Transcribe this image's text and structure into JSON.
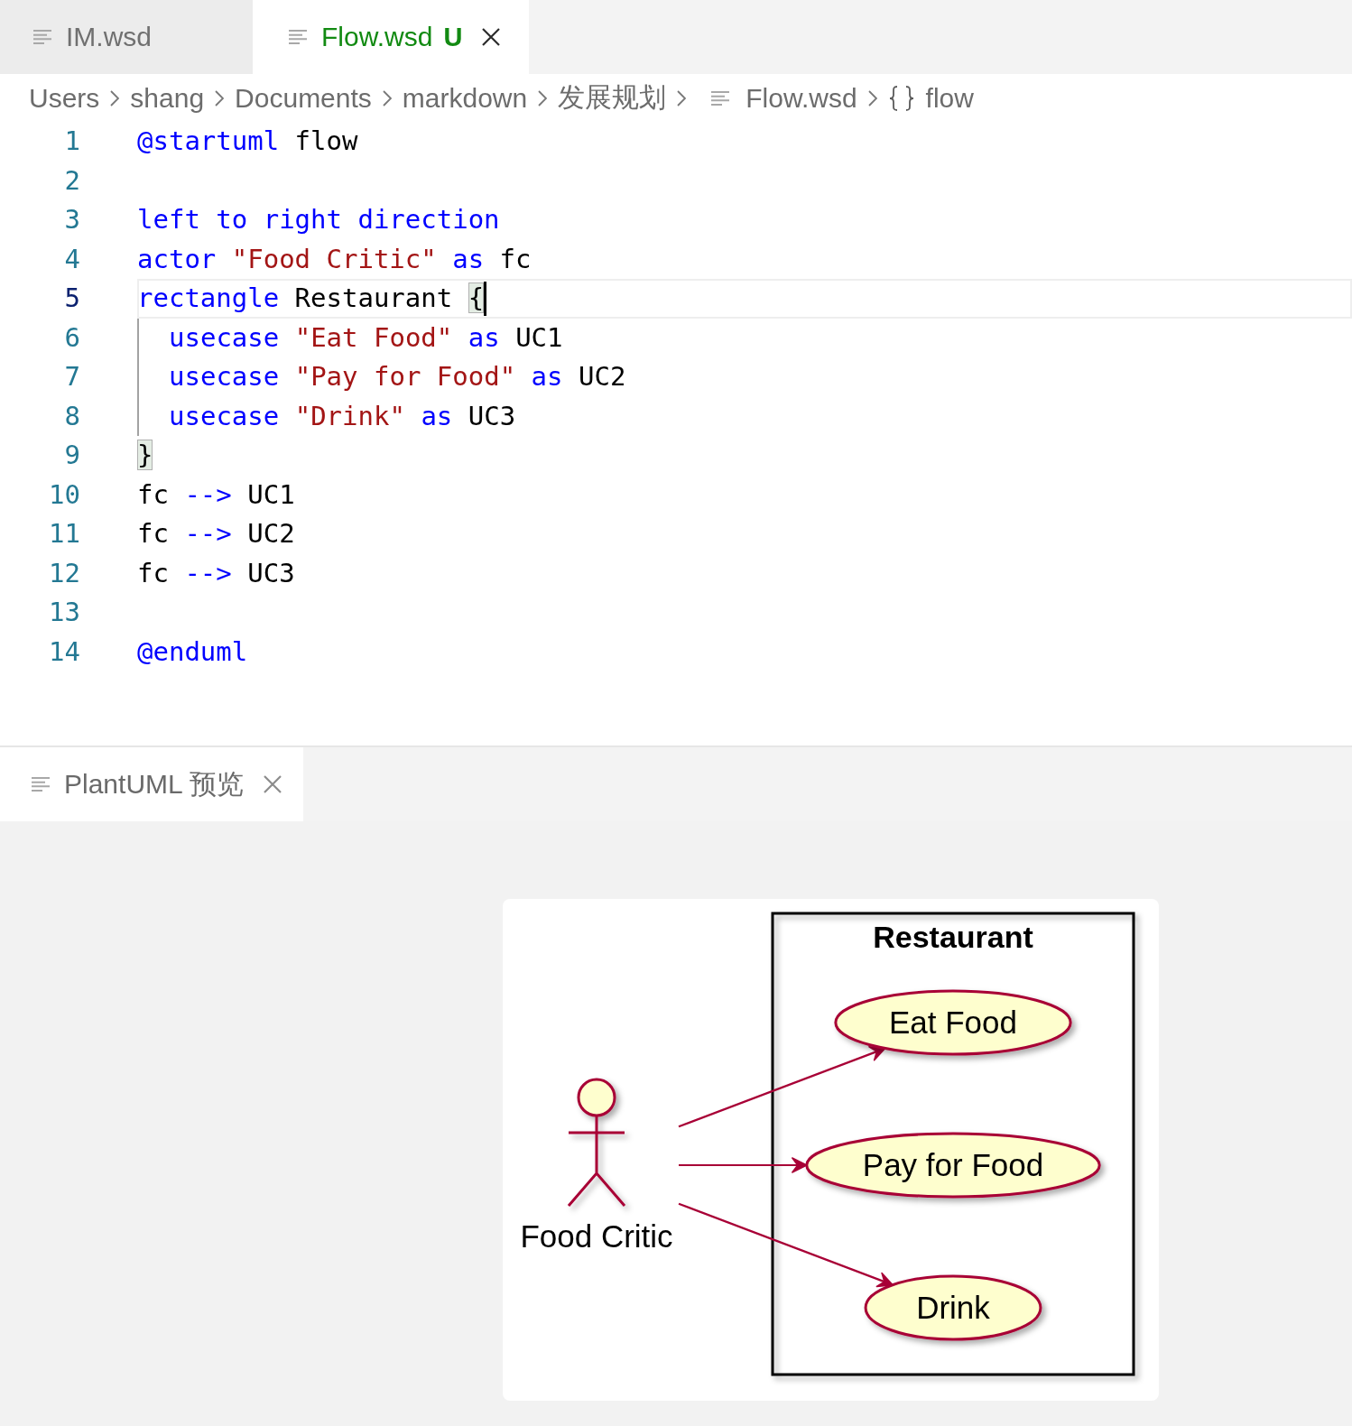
{
  "tabs": [
    {
      "label": "IM.wsd",
      "selected": false
    },
    {
      "label": "Flow.wsd",
      "status": "U",
      "selected": true
    }
  ],
  "breadcrumb": [
    {
      "kind": "folder",
      "label": "Users"
    },
    {
      "kind": "folder",
      "label": "shang"
    },
    {
      "kind": "folder",
      "label": "Documents"
    },
    {
      "kind": "folder",
      "label": "markdown"
    },
    {
      "kind": "folder",
      "label": "发展规划"
    },
    {
      "kind": "file",
      "label": "Flow.wsd"
    },
    {
      "kind": "symbol",
      "label": "flow"
    }
  ],
  "editor": {
    "lines": [
      {
        "number": "1",
        "current": false,
        "indented": false,
        "tokens": [
          {
            "kind": "keyword",
            "text": "@startuml "
          },
          {
            "kind": "plain",
            "text": "flow"
          }
        ]
      },
      {
        "number": "2",
        "current": false,
        "indented": false
      },
      {
        "number": "3",
        "current": false,
        "indented": false,
        "tokens": [
          {
            "kind": "keyword",
            "text": "left to right direction"
          }
        ]
      },
      {
        "number": "4",
        "current": false,
        "indented": false,
        "tokens": [
          {
            "kind": "keyword",
            "text": "actor "
          },
          {
            "kind": "string",
            "text": "\"Food Critic\" "
          },
          {
            "kind": "keyword",
            "text": "as "
          },
          {
            "kind": "plain",
            "text": "fc"
          }
        ]
      },
      {
        "number": "5",
        "current": true,
        "indented": false,
        "tokens": [
          {
            "kind": "keyword",
            "text": "rectangle "
          },
          {
            "kind": "plain",
            "text": "Restaurant "
          },
          {
            "kind": "bracket",
            "text": "{",
            "matched": true
          }
        ]
      },
      {
        "number": "6",
        "current": false,
        "indented": true,
        "tokens": [
          {
            "kind": "keyword",
            "text": "usecase "
          },
          {
            "kind": "string",
            "text": "\"Eat Food\" "
          },
          {
            "kind": "keyword",
            "text": "as "
          },
          {
            "kind": "plain",
            "text": "UC1"
          }
        ]
      },
      {
        "number": "7",
        "current": false,
        "indented": true,
        "tokens": [
          {
            "kind": "keyword",
            "text": "usecase "
          },
          {
            "kind": "string",
            "text": "\"Pay for Food\" "
          },
          {
            "kind": "keyword",
            "text": "as "
          },
          {
            "kind": "plain",
            "text": "UC2"
          }
        ]
      },
      {
        "number": "8",
        "current": false,
        "indented": true,
        "tokens": [
          {
            "kind": "keyword",
            "text": "usecase "
          },
          {
            "kind": "string",
            "text": "\"Drink\" "
          },
          {
            "kind": "keyword",
            "text": "as "
          },
          {
            "kind": "plain",
            "text": "UC3"
          }
        ]
      },
      {
        "number": "9",
        "current": false,
        "indented": false,
        "tokens": [
          {
            "kind": "bracket",
            "text": "}",
            "matched": true
          }
        ]
      },
      {
        "number": "10",
        "current": false,
        "indented": false,
        "tokens": [
          {
            "kind": "plain",
            "text": "fc "
          },
          {
            "kind": "keyword",
            "text": "--> "
          },
          {
            "kind": "plain",
            "text": "UC1"
          }
        ]
      },
      {
        "number": "11",
        "current": false,
        "indented": false,
        "tokens": [
          {
            "kind": "plain",
            "text": "fc "
          },
          {
            "kind": "keyword",
            "text": "--> "
          },
          {
            "kind": "plain",
            "text": "UC2"
          }
        ]
      },
      {
        "number": "12",
        "current": false,
        "indented": false,
        "tokens": [
          {
            "kind": "plain",
            "text": "fc "
          },
          {
            "kind": "keyword",
            "text": "--> "
          },
          {
            "kind": "plain",
            "text": "UC3"
          }
        ]
      },
      {
        "number": "13",
        "current": false,
        "indented": false
      },
      {
        "number": "14",
        "current": false,
        "indented": false,
        "tokens": [
          {
            "kind": "keyword",
            "text": "@enduml"
          }
        ]
      }
    ]
  },
  "panel": {
    "tabs": [
      {
        "label": "PlantUML 预览",
        "selected": true
      }
    ],
    "diagram": {
      "boundary": "Restaurant",
      "actor": "Food Critic",
      "use_cases": [
        {
          "label": "Eat Food",
          "arrow_from_actor": true
        },
        {
          "label": "Pay for Food",
          "arrow_from_actor": true
        },
        {
          "label": "Drink",
          "arrow_from_actor": true
        }
      ]
    }
  }
}
